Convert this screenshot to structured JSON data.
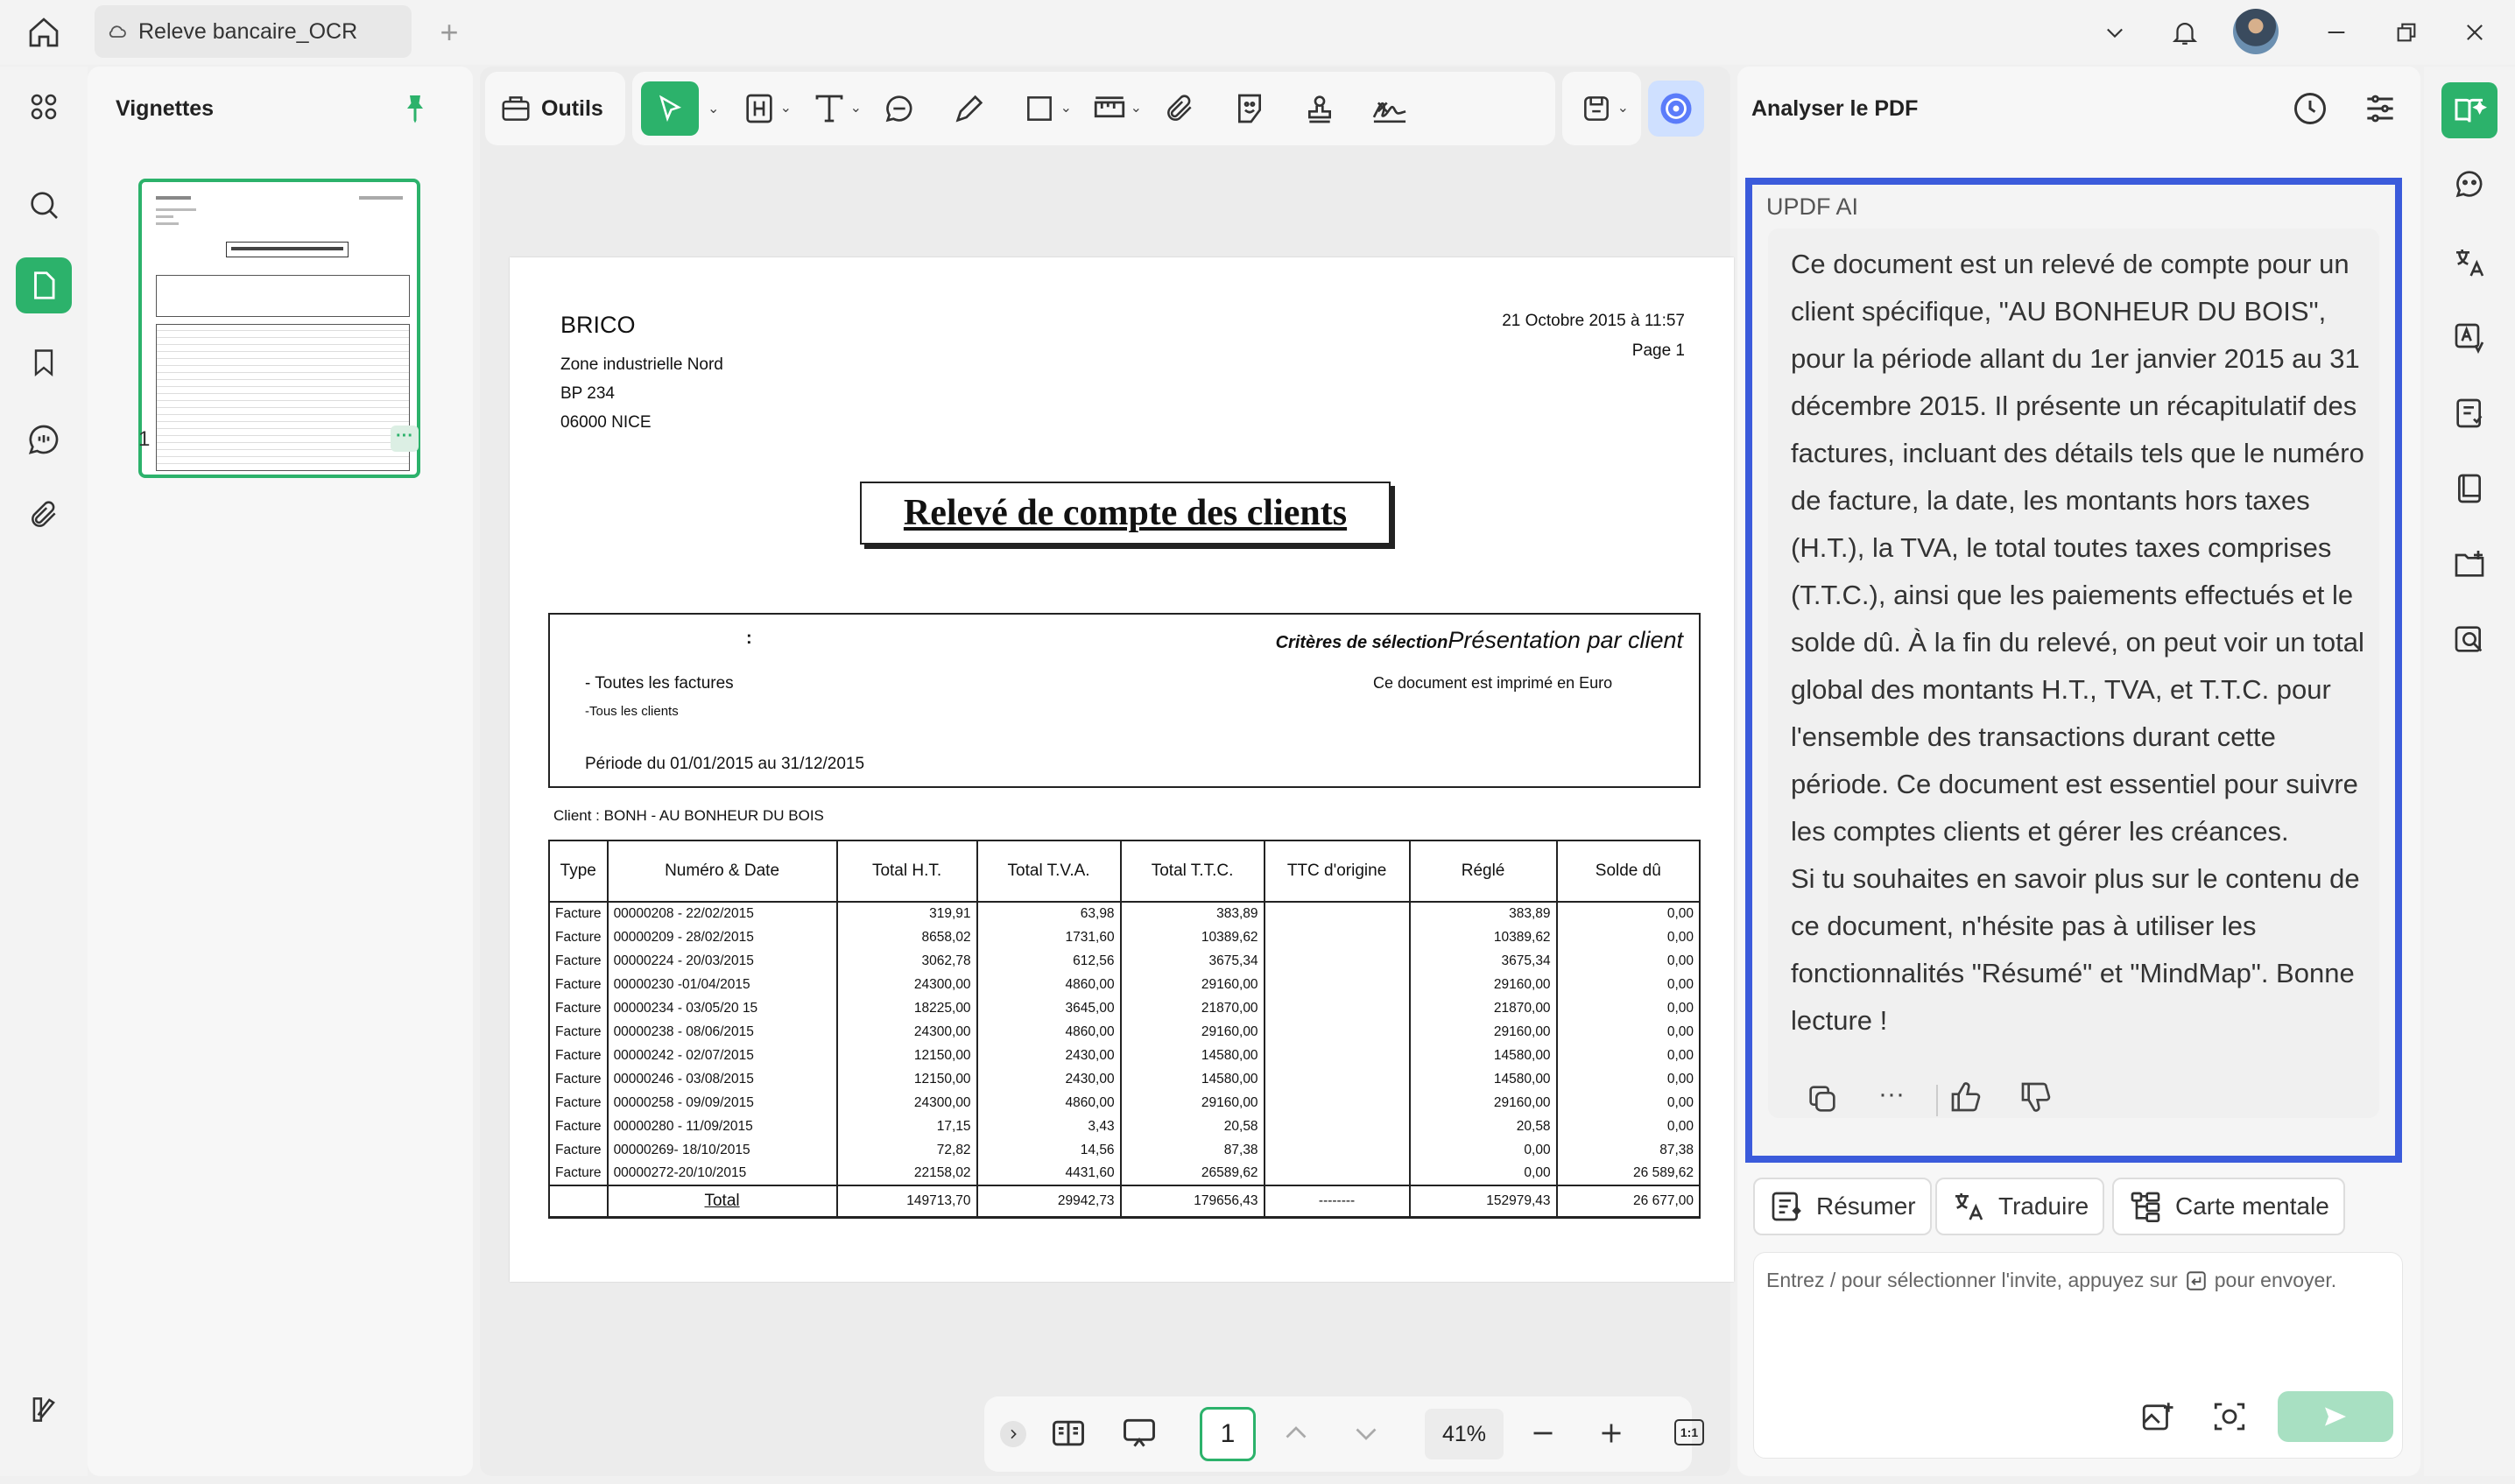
{
  "window": {
    "tab_title": "Releve bancaire_OCR",
    "add_tab": "+",
    "colors": {
      "accent": "#2cb26b",
      "ai_border": "#3b5bdb",
      "send": "#a8e0c2"
    }
  },
  "thumbnails": {
    "title": "Vignettes",
    "page_number": "1",
    "more": "···"
  },
  "toolbar": {
    "tools_label": "Outils"
  },
  "document": {
    "company": "BRICO",
    "address": [
      "Zone industrielle Nord",
      "BP 234",
      "06000 NICE"
    ],
    "date": "21 Octobre 2015 à 11:57",
    "page": "Page 1",
    "heading": "Relevé de compte des clients",
    "criteria_colon": ":",
    "criteria_label": "Critères de sélection",
    "presentation": "Présentation par client",
    "all_invoices": "- Toutes les factures",
    "all_clients": "-Tous les clients",
    "currency_note": "Ce document est imprimé en Euro",
    "period": "Période du 01/01/2015 au 31/12/2015",
    "client": "Client : BONH - AU BONHEUR DU BOIS",
    "columns": [
      "Type",
      "Numéro & Date",
      "Total H.T.",
      "Total T.V.A.",
      "Total T.T.C.",
      "TTC d'origine",
      "Réglé",
      "Solde dû"
    ],
    "rows": [
      [
        "Facture",
        "00000208 - 22/02/2015",
        "319,91",
        "63,98",
        "383,89",
        "",
        "383,89",
        "0,00"
      ],
      [
        "Facture",
        "00000209 - 28/02/2015",
        "8658,02",
        "1731,60",
        "10389,62",
        "",
        "10389,62",
        "0,00"
      ],
      [
        "Facture",
        "00000224 - 20/03/2015",
        "3062,78",
        "612,56",
        "3675,34",
        "",
        "3675,34",
        "0,00"
      ],
      [
        "Facture",
        "00000230 -01/04/2015",
        "24300,00",
        "4860,00",
        "29160,00",
        "",
        "29160,00",
        "0,00"
      ],
      [
        "Facture",
        "00000234 - 03/05/20 15",
        "18225,00",
        "3645,00",
        "21870,00",
        "",
        "21870,00",
        "0,00"
      ],
      [
        "Facture",
        "00000238 - 08/06/2015",
        "24300,00",
        "4860,00",
        "29160,00",
        "",
        "29160,00",
        "0,00"
      ],
      [
        "Facture",
        "00000242 - 02/07/2015",
        "12150,00",
        "2430,00",
        "14580,00",
        "",
        "14580,00",
        "0,00"
      ],
      [
        "Facture",
        "00000246 - 03/08/2015",
        "12150,00",
        "2430,00",
        "14580,00",
        "",
        "14580,00",
        "0,00"
      ],
      [
        "Facture",
        "00000258 - 09/09/2015",
        "24300,00",
        "4860,00",
        "29160,00",
        "",
        "29160,00",
        "0,00"
      ],
      [
        "Facture",
        "00000280 - 11/09/2015",
        "17,15",
        "3,43",
        "20,58",
        "",
        "20,58",
        "0,00"
      ],
      [
        "Facture",
        "00000269- 18/10/2015",
        "72,82",
        "14,56",
        "87,38",
        "",
        "0,00",
        "87,38"
      ],
      [
        "Facture",
        "00000272-20/10/2015",
        "22158,02",
        "4431,60",
        "26589,62",
        "",
        "0,00",
        "26 589,62"
      ]
    ],
    "total": [
      "",
      "Total",
      "149713,70",
      "29942,73",
      "179656,43",
      "--------",
      "152979,43",
      "26 677,00"
    ]
  },
  "bottom": {
    "page_value": "1",
    "zoom": "41%",
    "fit": "1:1"
  },
  "ai": {
    "panel_title": "Analyser le PDF",
    "label": "UPDF AI",
    "answer_p1": "Ce document est un relevé de compte pour un client spécifique, \"AU BONHEUR DU BOIS\", pour la période allant du 1er janvier 2015 au 31 décembre 2015. Il présente un récapitulatif des factures, incluant des détails tels que le numéro de facture, la date, les montants hors taxes (H.T.), la TVA, le total toutes taxes comprises (T.T.C.), ainsi que les paiements effectués et le solde dû. À la fin du relevé, on peut voir un total global des montants H.T., TVA, et T.T.C. pour l'ensemble des transactions durant cette période. Ce document est essentiel pour suivre les comptes clients et gérer les créances.",
    "answer_p2": "Si tu souhaites en savoir plus sur le contenu de ce document, n'hésite pas à utiliser les fonctionnalités \"Résumé\" et \"MindMap\". Bonne lecture !",
    "more": "···",
    "chip_summary": "Résumer",
    "chip_translate": "Traduire",
    "chip_mindmap": "Carte mentale",
    "prompt_part1": "Entrez / pour sélectionner l'invite, appuyez sur",
    "prompt_part2": "pour envoyer."
  },
  "icons": [
    "home-icon",
    "cloud-icon",
    "chevron-down-icon",
    "bell-icon",
    "avatar",
    "minimize-icon",
    "restore-icon",
    "close-icon",
    "grid-icon",
    "search-icon",
    "page-icon",
    "bookmark-icon",
    "comment-icon",
    "attachment-icon",
    "panel-icon",
    "pin-icon",
    "briefcase-icon",
    "cursor-icon",
    "heading-icon",
    "text-icon",
    "comment-icon",
    "pen-icon",
    "rectangle-icon",
    "measure-icon",
    "attachment-icon",
    "sticker-icon",
    "stamp-icon",
    "signature-icon",
    "save-icon",
    "ai-icon",
    "history-icon",
    "settings-icon",
    "copy-icon",
    "thumbs-up-icon",
    "thumbs-down-icon",
    "send-icon"
  ]
}
